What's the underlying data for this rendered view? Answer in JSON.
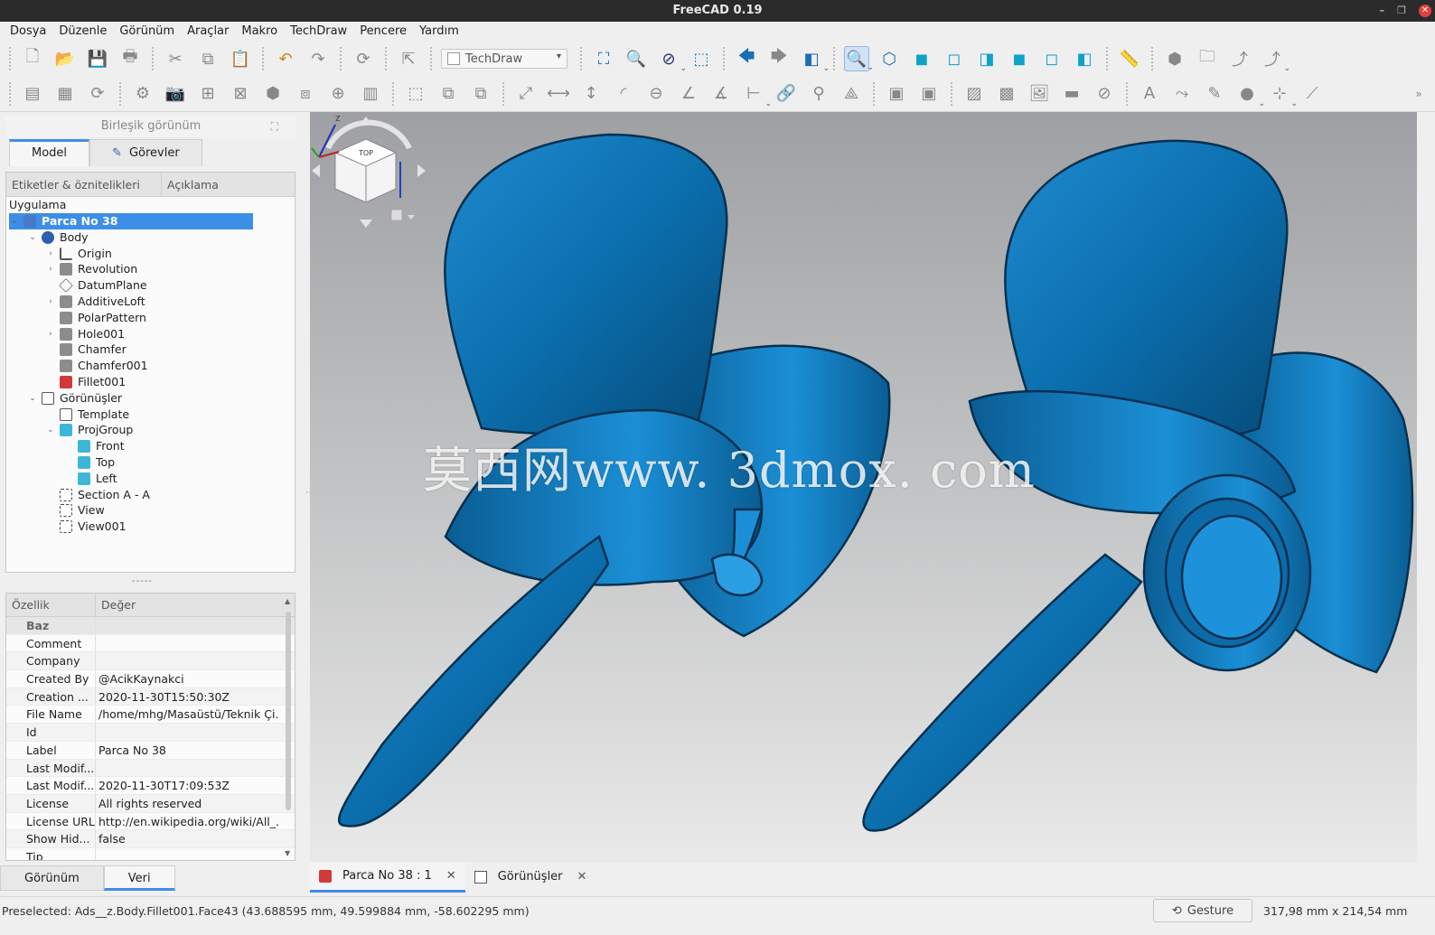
{
  "window": {
    "title": "FreeCAD 0.19"
  },
  "menu": [
    "Dosya",
    "Düzenle",
    "Görünüm",
    "Araçlar",
    "Makro",
    "TechDraw",
    "Pencere",
    "Yardım"
  ],
  "toolbar": {
    "workbench": "TechDraw"
  },
  "combo": {
    "title": "Birleşik görünüm",
    "tabs": [
      "Model",
      "Görevler"
    ],
    "tree_headers": [
      "Etiketler & öznitelikleri",
      "Açıklama"
    ],
    "tree_root": "Uygulama",
    "tree": [
      {
        "label": "Parca No 38",
        "icon": "part-icon",
        "depth": 0,
        "twisty": "open"
      },
      {
        "label": "Body",
        "icon": "body-icon",
        "depth": 1,
        "twisty": "open"
      },
      {
        "label": "Origin",
        "icon": "axes-icon",
        "depth": 2,
        "twisty": "closed"
      },
      {
        "label": "Revolution",
        "icon": "revolution-icon",
        "depth": 2,
        "twisty": "closed"
      },
      {
        "label": "DatumPlane",
        "icon": "datum-plane-icon",
        "depth": 2,
        "twisty": ""
      },
      {
        "label": "AdditiveLoft",
        "icon": "loft-icon",
        "depth": 2,
        "twisty": "closed"
      },
      {
        "label": "PolarPattern",
        "icon": "polar-pattern-icon",
        "depth": 2,
        "twisty": ""
      },
      {
        "label": "Hole001",
        "icon": "hole-icon",
        "depth": 2,
        "twisty": "closed"
      },
      {
        "label": "Chamfer",
        "icon": "chamfer-icon",
        "depth": 2,
        "twisty": ""
      },
      {
        "label": "Chamfer001",
        "icon": "chamfer-icon",
        "depth": 2,
        "twisty": ""
      },
      {
        "label": "Fillet001",
        "icon": "fillet-icon",
        "depth": 2,
        "twisty": ""
      },
      {
        "label": "Görünüşler",
        "icon": "page-icon",
        "depth": 1,
        "twisty": "open"
      },
      {
        "label": "Template",
        "icon": "template-icon",
        "depth": 2,
        "twisty": ""
      },
      {
        "label": "ProjGroup",
        "icon": "projgroup-icon",
        "depth": 2,
        "twisty": "open"
      },
      {
        "label": "Front",
        "icon": "projview-icon",
        "depth": 3,
        "twisty": ""
      },
      {
        "label": "Top",
        "icon": "projview-icon",
        "depth": 3,
        "twisty": ""
      },
      {
        "label": "Left",
        "icon": "projview-icon",
        "depth": 3,
        "twisty": ""
      },
      {
        "label": "Section A - A",
        "icon": "view-icon",
        "depth": 2,
        "twisty": ""
      },
      {
        "label": "View",
        "icon": "view-icon",
        "depth": 2,
        "twisty": ""
      },
      {
        "label": "View001",
        "icon": "view-icon",
        "depth": 2,
        "twisty": ""
      }
    ],
    "splitter": "-----",
    "prop_headers": [
      "Özellik",
      "Değer"
    ],
    "prop_group": "Baz",
    "props": [
      [
        "Comment",
        ""
      ],
      [
        "Company",
        ""
      ],
      [
        "Created By",
        "@AcikKaynakci"
      ],
      [
        "Creation ...",
        "2020-11-30T15:50:30Z"
      ],
      [
        "File Name",
        "/home/mhg/Masaüstü/Teknik Çi..."
      ],
      [
        "Id",
        ""
      ],
      [
        "Label",
        "Parca No 38"
      ],
      [
        "Last Modif...",
        ""
      ],
      [
        "Last Modif...",
        "2020-11-30T17:09:53Z"
      ],
      [
        "License",
        "All rights reserved"
      ],
      [
        "License URL",
        "http://en.wikipedia.org/wiki/All_..."
      ],
      [
        "Show Hid...",
        "false"
      ],
      [
        "Tip",
        ""
      ]
    ],
    "bottom_tabs": [
      "Görünüm",
      "Veri"
    ]
  },
  "viewport": {
    "watermark": "莫西网www. 3dmox. com",
    "model_color": "#0b6fae"
  },
  "doc_tabs": [
    {
      "label": "Parca No 38 : 1"
    },
    {
      "label": "Görünüşler"
    }
  ],
  "status": {
    "preselected": "Preselected: Ads__z.Body.Fillet001.Face43 (43.688595 mm, 49.599884 mm, -58.602295 mm)",
    "nav_style": "Gesture",
    "dimensions": "317,98 mm x 214,54 mm"
  }
}
